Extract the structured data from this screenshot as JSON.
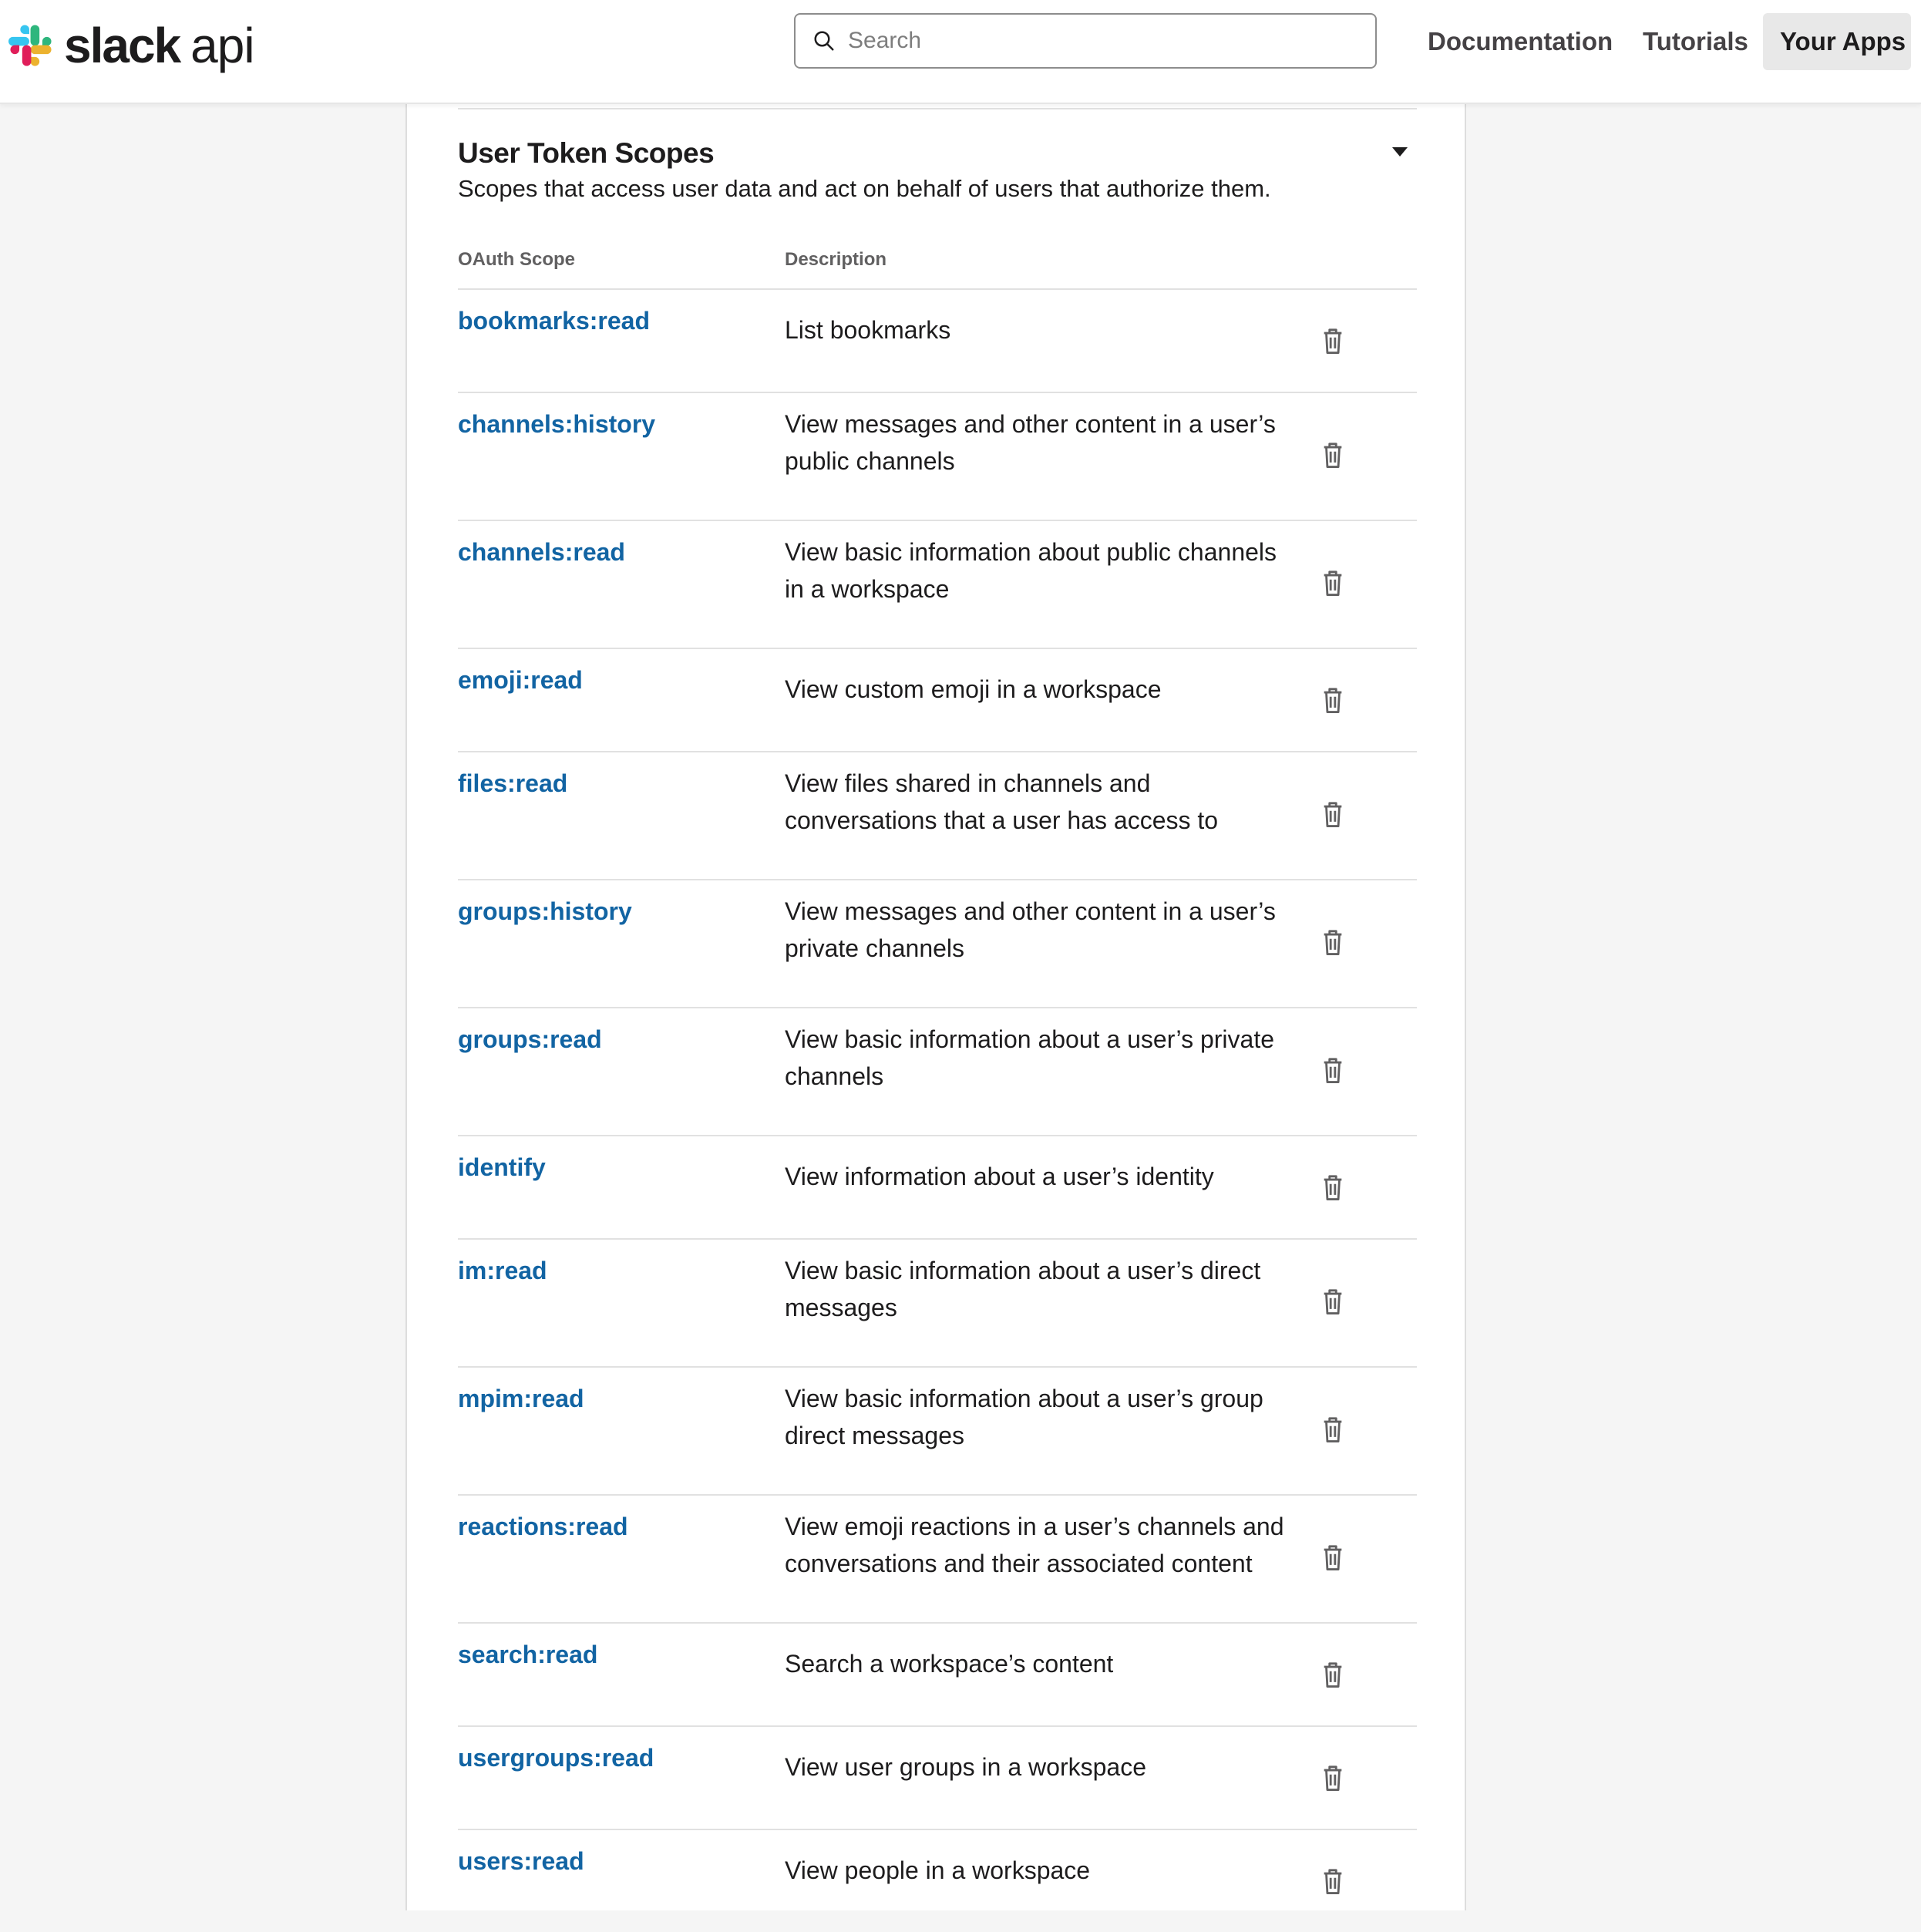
{
  "brand": {
    "name": "slack",
    "suffix": "api",
    "colors": {
      "blue": "#36c5f0",
      "green": "#2eb67d",
      "yellow": "#ecb22e",
      "red": "#e01e5a"
    }
  },
  "search": {
    "placeholder": "Search",
    "icon": "search-icon"
  },
  "nav": {
    "documentation": "Documentation",
    "tutorials": "Tutorials",
    "your_apps": "Your Apps"
  },
  "section": {
    "title": "User Token Scopes",
    "subtitle": "Scopes that access user data and act on behalf of users that authorize them.",
    "columns": {
      "scope": "OAuth Scope",
      "description": "Description"
    }
  },
  "scopes": [
    {
      "name": "bookmarks:read",
      "description": "List bookmarks"
    },
    {
      "name": "channels:history",
      "description": "View messages and other content in a user’s public channels"
    },
    {
      "name": "channels:read",
      "description": "View basic information about public channels in a workspace"
    },
    {
      "name": "emoji:read",
      "description": "View custom emoji in a workspace"
    },
    {
      "name": "files:read",
      "description": "View files shared in channels and conversations that a user has access to"
    },
    {
      "name": "groups:history",
      "description": "View messages and other content in a user’s private channels"
    },
    {
      "name": "groups:read",
      "description": "View basic information about a user’s private channels"
    },
    {
      "name": "identify",
      "description": "View information about a user’s identity"
    },
    {
      "name": "im:read",
      "description": "View basic information about a user’s direct messages"
    },
    {
      "name": "mpim:read",
      "description": "View basic information about a user’s group direct messages"
    },
    {
      "name": "reactions:read",
      "description": "View emoji reactions in a user’s channels and conversations and their associated content"
    },
    {
      "name": "search:read",
      "description": "Search a workspace’s content"
    },
    {
      "name": "usergroups:read",
      "description": "View user groups in a workspace"
    },
    {
      "name": "users:read",
      "description": "View people in a workspace"
    }
  ],
  "colors": {
    "link": "#1264a3",
    "text": "#1d1c1d",
    "muted": "#616061",
    "divider": "#e1e1e1",
    "page_background": "#f5f5f5"
  }
}
